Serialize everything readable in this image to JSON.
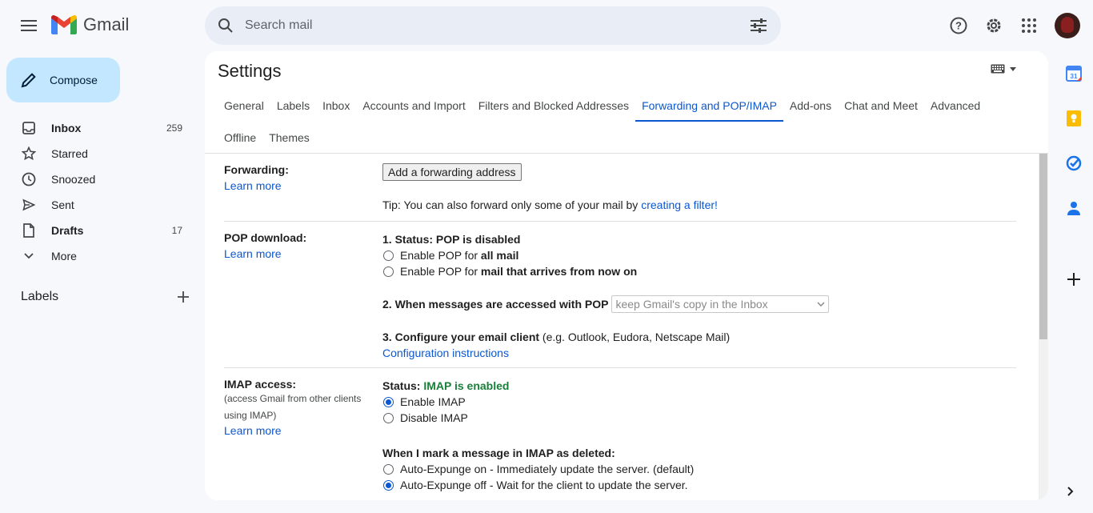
{
  "app": {
    "name": "Gmail"
  },
  "search": {
    "placeholder": "Search mail"
  },
  "compose": {
    "label": "Compose"
  },
  "nav": {
    "items": [
      {
        "label": "Inbox",
        "count": "259",
        "icon": "inbox-icon"
      },
      {
        "label": "Starred",
        "count": "",
        "icon": "star-icon"
      },
      {
        "label": "Snoozed",
        "count": "",
        "icon": "clock-icon"
      },
      {
        "label": "Sent",
        "count": "",
        "icon": "send-icon"
      },
      {
        "label": "Drafts",
        "count": "17",
        "icon": "draft-icon"
      },
      {
        "label": "More",
        "count": "",
        "icon": "chevron-down-icon"
      }
    ],
    "labels_title": "Labels"
  },
  "settings": {
    "title": "Settings",
    "tabs_row1": [
      "General",
      "Labels",
      "Inbox",
      "Accounts and Import",
      "Filters and Blocked Addresses",
      "Forwarding and POP/IMAP",
      "Add-ons",
      "Chat and Meet",
      "Advanced"
    ],
    "tabs_row2": [
      "Offline",
      "Themes"
    ],
    "active_tab": "Forwarding and POP/IMAP"
  },
  "forwarding": {
    "label": "Forwarding:",
    "learn_more": "Learn more",
    "button": "Add a forwarding address",
    "tip_prefix": "Tip: You can also forward only some of your mail by ",
    "tip_link": "creating a filter!"
  },
  "pop": {
    "label": "POP download:",
    "learn_more": "Learn more",
    "status": "1. Status: POP is disabled",
    "opt1_prefix": "Enable POP for ",
    "opt1_bold": "all mail",
    "opt2_prefix": "Enable POP for ",
    "opt2_bold": "mail that arrives from now on",
    "accessed_label": "2. When messages are accessed with POP",
    "accessed_value": "keep Gmail's copy in the Inbox",
    "configure_bold": "3. Configure your email client",
    "configure_rest": " (e.g. Outlook, Eudora, Netscape Mail)",
    "config_link": "Configuration instructions"
  },
  "imap": {
    "label": "IMAP access:",
    "sub1": "(access Gmail from other clients",
    "sub2": "using IMAP)",
    "learn_more": "Learn more",
    "status_prefix": "Status: ",
    "status_value": "IMAP is enabled",
    "enable": "Enable IMAP",
    "disable": "Disable IMAP",
    "deleted_title": "When I mark a message in IMAP as deleted:",
    "expunge_on": "Auto-Expunge on - Immediately update the server. (default)",
    "expunge_off": "Auto-Expunge off - Wait for the client to update the server."
  }
}
